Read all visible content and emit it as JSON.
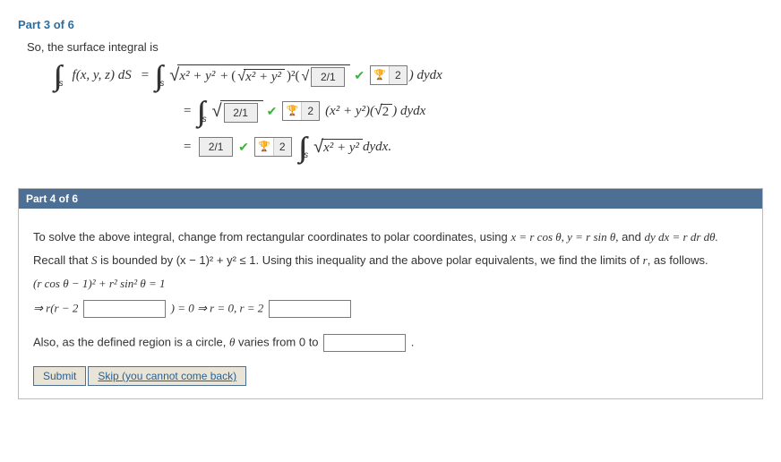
{
  "part3": {
    "header": "Part 3 of 6",
    "intro": "So, the surface integral is",
    "line1": {
      "lhs_func": "f(x, y, z) dS",
      "inner1": "x² + y²",
      "inner2": "x² + y²",
      "box1": "2/1",
      "trophy_val": "2",
      "tail": " )  dydx"
    },
    "line2": {
      "box1": "2/1",
      "trophy_val": "2",
      "tail_inner": "(x² + y²)(",
      "tail_sqrt": "2",
      "tail_end": ")  dydx"
    },
    "line3": {
      "box1": "2/1",
      "trophy_val": "2",
      "sqrt_inner": "x² + y²",
      "tail": " dydx."
    }
  },
  "part4": {
    "header": "Part 4 of 6",
    "p1_a": "To solve the above integral, change from rectangular coordinates to polar coordinates, using  ",
    "p1_b": "x = r cos θ,  y = r sin θ,",
    "p1_c": "  and  ",
    "p1_d": "dy dx = r dr dθ.",
    "p2_a": "Recall that ",
    "p2_b": "S",
    "p2_c": " is bounded by  (x − 1)² + y² ≤ 1.  Using this inequality and the above polar equivalents, we find the limits of ",
    "p2_d": "r",
    "p2_e": ", as follows.",
    "eq1": "(r cos θ − 1)² + r² sin² θ  =  1",
    "eq2_left": "⇒ r(r − 2",
    "eq2_mid": ")  =  0 ⇒ r = 0,  r = 2",
    "p3_a": "Also, as the defined region is a circle, ",
    "p3_b": "θ",
    "p3_c": " varies from 0 to",
    "p3_d": ".",
    "btn_submit": "Submit",
    "btn_skip": "Skip (you cannot come back)"
  }
}
